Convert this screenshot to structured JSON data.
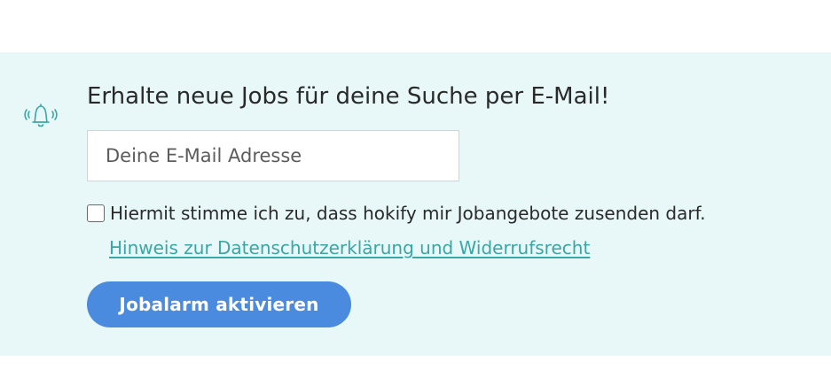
{
  "alert_panel": {
    "bell_icon": "bell-icon",
    "headline": "Erhalte neue Jobs für deine Suche per E-Mail!",
    "email_input": {
      "placeholder": "Deine E-Mail Adresse",
      "value": ""
    },
    "consent": {
      "checked": false,
      "label": "Hiermit stimme ich zu, dass hokify mir Jobangebote zusenden darf."
    },
    "privacy_link": "Hinweis zur Datenschutzerklärung und Widerrufsrecht",
    "submit_label": "Jobalarm aktivieren"
  },
  "colors": {
    "panel_background": "#e8f7f7",
    "accent_teal": "#3aa6a6",
    "button_blue": "#4a8be0"
  }
}
